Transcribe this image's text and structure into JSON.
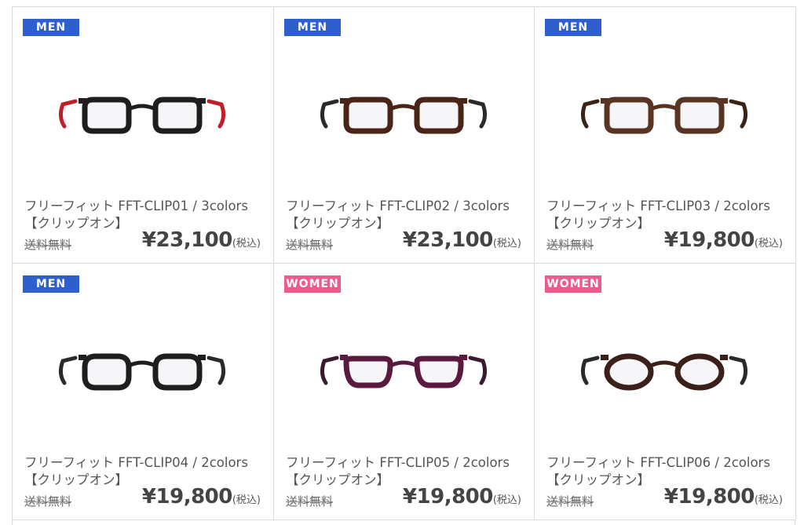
{
  "products": [
    {
      "badge": "MEN",
      "badge_type": "men",
      "name_line1": "フリーフィット FFT-CLIP01 / 3colors",
      "name_line2": "【クリップオン】",
      "shipping": "送料無料",
      "price": "¥23,100",
      "tax": "(税込)",
      "frame_color": "#1e1e1e",
      "temple_color": "#c21e2a",
      "lens_shape": "rect"
    },
    {
      "badge": "MEN",
      "badge_type": "men",
      "name_line1": "フリーフィット FFT-CLIP02 / 3colors",
      "name_line2": "【クリップオン】",
      "shipping": "送料無料",
      "price": "¥23,100",
      "tax": "(税込)",
      "frame_color": "#4a2416",
      "temple_color": "#2a2a2a",
      "lens_shape": "rect"
    },
    {
      "badge": "MEN",
      "badge_type": "men",
      "name_line1": "フリーフィット FFT-CLIP03 / 2colors",
      "name_line2": "【クリップオン】",
      "shipping": "送料無料",
      "price": "¥19,800",
      "tax": "(税込)",
      "frame_color": "#5a3422",
      "temple_color": "#3a2418",
      "lens_shape": "rect"
    },
    {
      "badge": "MEN",
      "badge_type": "men",
      "name_line1": "フリーフィット FFT-CLIP04 / 2colors",
      "name_line2": "【クリップオン】",
      "shipping": "送料無料",
      "price": "¥19,800",
      "tax": "(税込)",
      "frame_color": "#1e1e1e",
      "temple_color": "#2a2a2a",
      "lens_shape": "round-rect"
    },
    {
      "badge": "WOMEN",
      "badge_type": "women",
      "name_line1": "フリーフィット FFT-CLIP05 / 2colors",
      "name_line2": "【クリップオン】",
      "shipping": "送料無料",
      "price": "¥19,800",
      "tax": "(税込)",
      "frame_color": "#5a1a40",
      "temple_color": "#3a1a2e",
      "lens_shape": "oval"
    },
    {
      "badge": "WOMEN",
      "badge_type": "women",
      "name_line1": "フリーフィット FFT-CLIP06 / 2colors",
      "name_line2": "【クリップオン】",
      "shipping": "送料無料",
      "price": "¥19,800",
      "tax": "(税込)",
      "frame_color": "#3a2018",
      "temple_color": "#2a2a2a",
      "lens_shape": "round"
    }
  ],
  "colors": {
    "men_badge": "#2f5fcc",
    "women_badge": "#ef5a8e"
  }
}
